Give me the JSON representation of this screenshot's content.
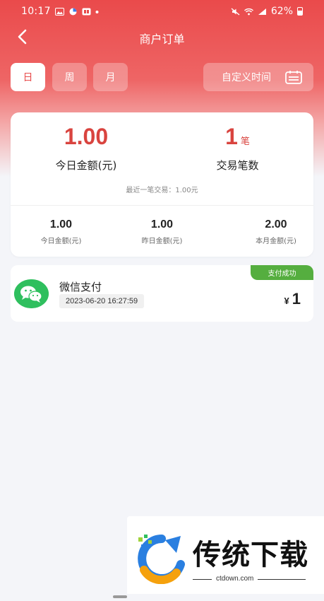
{
  "status_bar": {
    "time": "10:17",
    "battery": "62%"
  },
  "nav": {
    "title": "商户订单"
  },
  "period": {
    "tabs": [
      "日",
      "周",
      "月"
    ],
    "active": "日",
    "custom_label": "自定义时间"
  },
  "stats": {
    "today_amount": "1.00",
    "today_amount_label": "今日金额(元)",
    "trade_count": "1",
    "trade_count_unit": "笔",
    "trade_count_label": "交易笔数",
    "last_trade": "最近一笔交易：1.00元",
    "summary": [
      {
        "value": "1.00",
        "label": "今日金额(元)"
      },
      {
        "value": "1.00",
        "label": "昨日金额(元)"
      },
      {
        "value": "2.00",
        "label": "本月金额(元)"
      }
    ]
  },
  "orders": [
    {
      "method": "微信支付",
      "time": "2023-06-20 16:27:59",
      "status": "支付成功",
      "currency": "¥",
      "amount": "1"
    }
  ],
  "watermark": {
    "text": "传统下载",
    "url": "ctdown.com"
  },
  "colors": {
    "accent": "#e84b4b",
    "success": "#55ae3f",
    "wechat": "#2fbf5e"
  }
}
